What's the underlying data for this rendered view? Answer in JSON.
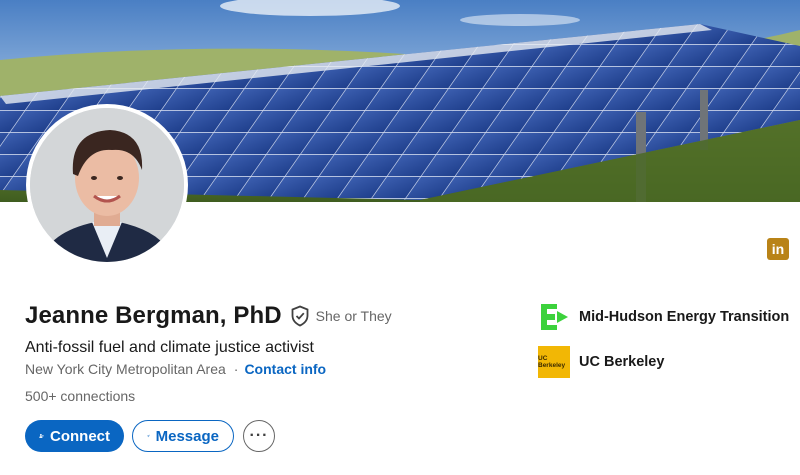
{
  "profile": {
    "name": "Jeanne Bergman, PhD",
    "pronouns": "She or They",
    "headline": "Anti-fossil fuel and climate justice activist",
    "location": "New York City Metropolitan Area",
    "separator": "·",
    "contact_info": "Contact info",
    "connections": "500+ connections"
  },
  "actions": {
    "connect": "Connect",
    "message": "Message",
    "more": "···"
  },
  "orgs": [
    {
      "name": "Mid-Hudson Energy Transition",
      "logo_color": "#3cd23c"
    },
    {
      "name": "UC Berkeley",
      "logo_text": "UC Berkeley",
      "logo_color": "#f2b705"
    }
  ],
  "badge": {
    "label": "in",
    "color": "#b98317"
  },
  "colors": {
    "accent": "#0a66c2",
    "text": "#191919",
    "muted": "#666666"
  },
  "icons": {
    "verify": "shield-check-icon",
    "connect": "add-person-icon",
    "message": "send-icon",
    "more": "ellipsis-icon"
  }
}
